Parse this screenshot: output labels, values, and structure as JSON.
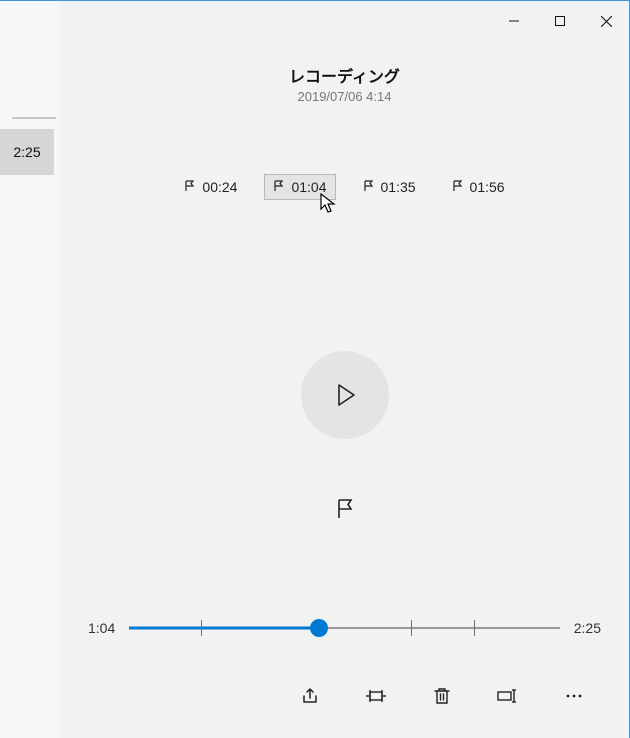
{
  "recording": {
    "title": "レコーディング",
    "date": "2019/07/06 4:14"
  },
  "sidebar": {
    "thumbnail_label": "2:25"
  },
  "markers": [
    {
      "time": "00:24",
      "selected": false
    },
    {
      "time": "01:04",
      "selected": true
    },
    {
      "time": "01:35",
      "selected": false
    },
    {
      "time": "01:56",
      "selected": false
    }
  ],
  "playback": {
    "current_time": "1:04",
    "duration": "2:25",
    "progress_percent": 44.1
  },
  "marker_positions_percent": [
    16.6,
    44.1,
    65.5,
    80.0
  ],
  "colors": {
    "accent": "#0078d4",
    "window_border": "#3a97dd"
  }
}
